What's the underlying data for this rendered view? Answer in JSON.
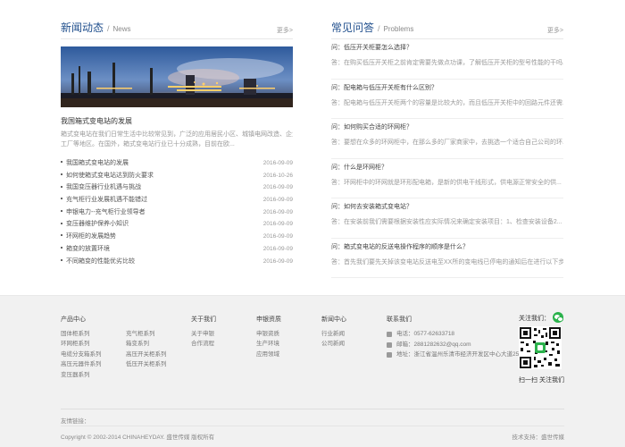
{
  "news": {
    "title": "新闻动态",
    "title_en": "News",
    "more": "更多>",
    "featured_title": "我国箱式变电站的发展",
    "featured_desc_line1": "箱式变电站在我们日常生活中比较常见到，广泛的应用居民小区、城镇电网改造、企业",
    "featured_desc_line2": "工厂等地区。在国外，箱式变电站行业已十分成熟，目前在欧...",
    "items": [
      {
        "title": "我国箱式变电站的发展",
        "date": "2016-09-09"
      },
      {
        "title": "如何使箱式变电站达到防火要求",
        "date": "2016-10-26"
      },
      {
        "title": "我国变压器行业机遇与挑战",
        "date": "2016-09-09"
      },
      {
        "title": "充气柜行业发展机遇不能错过",
        "date": "2016-09-09"
      },
      {
        "title": "申银电力--充气柜行业领导者",
        "date": "2016-09-09"
      },
      {
        "title": "变压器维护保养小知识",
        "date": "2016-09-09"
      },
      {
        "title": "环网柜的发展趋势",
        "date": "2016-09-09"
      },
      {
        "title": "箱变的放置环境",
        "date": "2016-09-09"
      },
      {
        "title": "不同箱变的性能优劣比较",
        "date": "2016-09-09"
      }
    ]
  },
  "faq": {
    "title": "常见问答",
    "title_en": "Problems",
    "more": "更多>",
    "items": [
      {
        "q": "问：低压开关柜要怎么选择？",
        "a": "答：在购买低压开关柜之前肯定需要先做点功课，了解低压开关柜的型号性能的干吗..."
      },
      {
        "q": "问：配电箱与低压开关柜有什么区别？",
        "a": "答：配电箱与低压开关柜两个的容量是比较大的，而且低压开关柜中的回路元件还需..."
      },
      {
        "q": "问：如何购买合适的环网柜？",
        "a": "答：要想在众多的环网柜中，在那么多的厂家商家中，去挑选一个适合自己公司的环..."
      },
      {
        "q": "问：什么是环网柜？",
        "a": "答：环网柜中的环网就是环形配电箱，是新的供电干线形式，供电源正常安全的供..."
      },
      {
        "q": "问：如何去安装箱式变电站？",
        "a": "答：在安装前我们需要根据安装性应实际情况来确定安装项目：1、检查安装设备2..."
      },
      {
        "q": "问：箱式变电站的反送电操作程序的顺序是什么？",
        "a": "答：首先我们要先关掉该变电站反送电至XX所的变电线已停电的通知后在进行以下步..."
      }
    ]
  },
  "footer": {
    "products": {
      "title": "产品中心",
      "col1": [
        "固体柜系列",
        "环网柜系列",
        "电缆分支箱系列",
        "高压元器件系列",
        "变压器系列"
      ],
      "col2": [
        "充气柜系列",
        "箱变系列",
        "高压开关柜系列",
        "低压开关柜系列"
      ]
    },
    "about": {
      "title": "关于我们",
      "items": [
        "关于申银",
        "合作流程"
      ]
    },
    "qualify": {
      "title": "申银资质",
      "items": [
        "申银资质",
        "生产环境",
        "应用领域"
      ]
    },
    "newscenter": {
      "title": "新闻中心",
      "items": [
        "行业新闻",
        "公司新闻"
      ]
    },
    "contact": {
      "title": "联系我们",
      "phone": "电话：0577-62633718",
      "email": "邮箱：2881282632@qq.com",
      "address": "地址：浙江省温州乐清市经济开发区中心大道251号"
    },
    "follow_label": "关注我们：",
    "scan_label": "扫一扫 关注我们",
    "links_label": "友情链接：",
    "copyright": "Copyright © 2002-2014 CHINAHEYDAY. 盛世传媒 版权所有",
    "support": "技术支持：盛世传媒"
  },
  "colors": {
    "accent": "#1f4e8c",
    "footer_bg": "#f1f1f1",
    "wechat": "#2bb24c"
  }
}
